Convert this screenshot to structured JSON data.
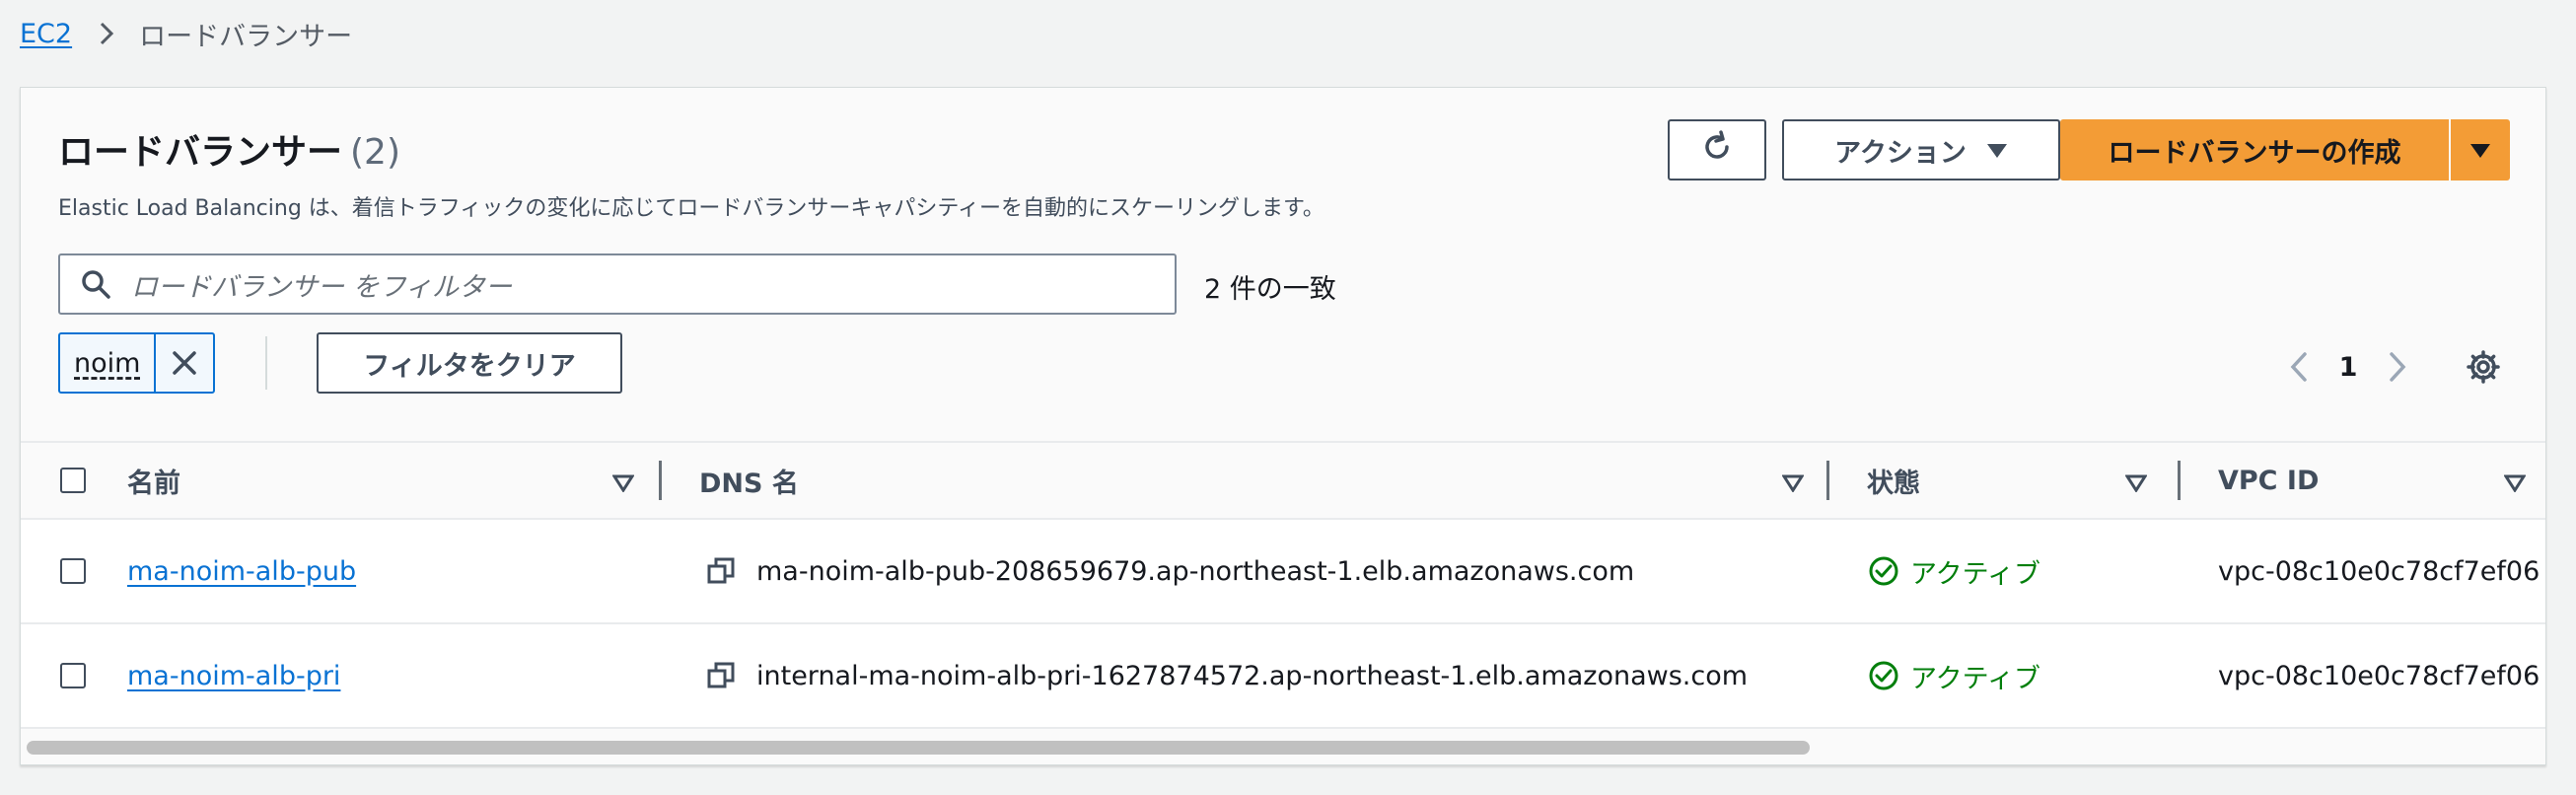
{
  "breadcrumb": {
    "items": [
      "EC2",
      "ロードバランサー"
    ]
  },
  "header": {
    "title": "ロードバランサー",
    "count": "(2)",
    "description": "Elastic Load Balancing は、着信トラフィックの変化に応じてロードバランサーキャパシティーを自動的にスケーリングします。",
    "actions_label": "アクション",
    "create_label": "ロードバランサーの作成"
  },
  "filter": {
    "placeholder": "ロードバランサー をフィルター",
    "match_text": "2 件の一致",
    "token": "noim",
    "clear_label": "フィルタをクリア"
  },
  "pagination": {
    "page": "1"
  },
  "table": {
    "columns": [
      "名前",
      "DNS 名",
      "状態",
      "VPC ID"
    ],
    "rows": [
      {
        "name": "ma-noim-alb-pub",
        "dns": "ma-noim-alb-pub-208659679.ap-northeast-1.elb.amazonaws.com",
        "state": "アクティブ",
        "vpc": "vpc-08c10e0c78cf7ef06"
      },
      {
        "name": "ma-noim-alb-pri",
        "dns": "internal-ma-noim-alb-pri-1627874572.ap-northeast-1.elb.amazonaws.com",
        "state": "アクティブ",
        "vpc": "vpc-08c10e0c78cf7ef06"
      }
    ]
  },
  "colors": {
    "primary": "#f39c36",
    "link": "#0972d3",
    "success": "#037f0c",
    "background": "#f2f3f3"
  },
  "icons": [
    "chevron-right-icon",
    "refresh-icon",
    "caret-down-icon",
    "search-icon",
    "close-icon",
    "chevron-left-icon",
    "settings-icon",
    "sort-icon",
    "copy-icon",
    "check-circle-icon"
  ]
}
